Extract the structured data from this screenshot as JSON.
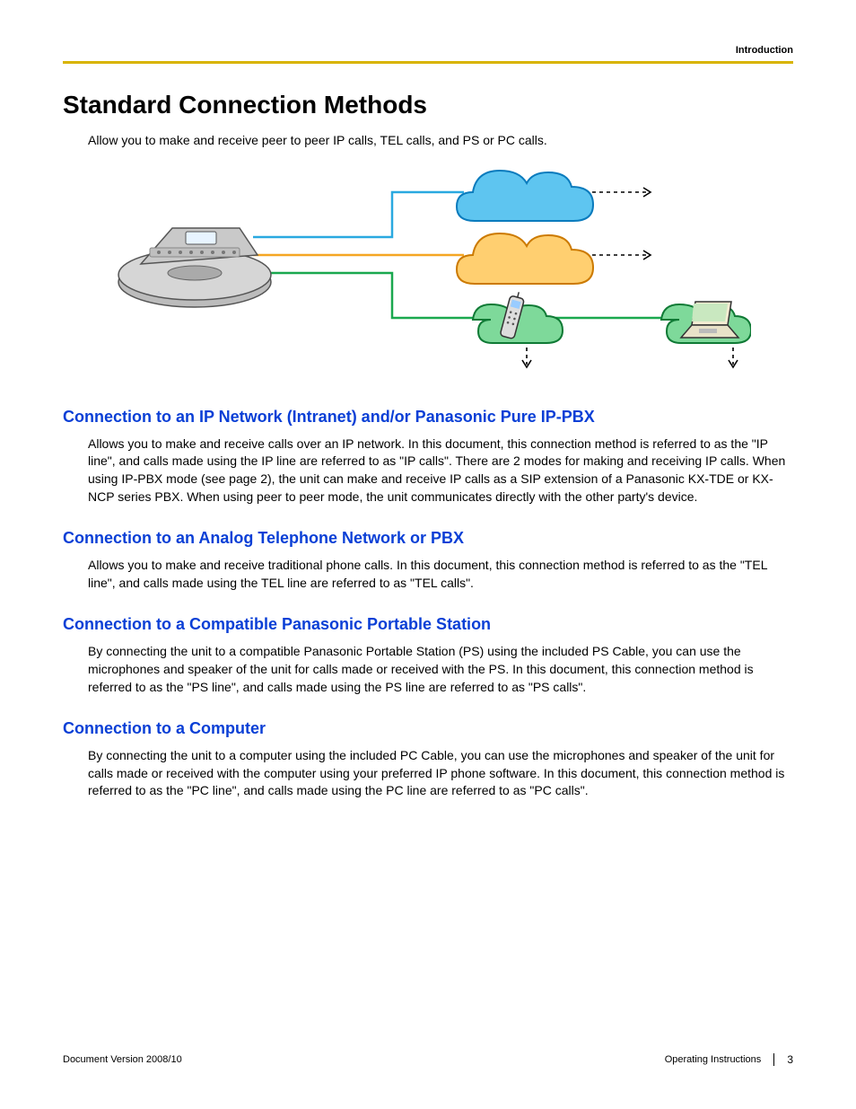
{
  "header": {
    "section_label": "Introduction"
  },
  "title": "Standard Connection Methods",
  "intro": "Allow you to make and receive peer to peer IP calls, TEL calls, and PS or PC calls.",
  "sections": [
    {
      "heading": "Connection to an IP Network (Intranet) and/or Panasonic Pure IP-PBX",
      "body": "Allows you to make and receive calls over an IP network.\nIn this document, this connection method is referred to as the \"IP line\", and calls made using the IP line are referred to as \"IP calls\". There are 2 modes for making and receiving IP calls. When using IP-PBX mode (see page 2), the unit can make and receive IP calls as a SIP extension of a Panasonic KX-TDE or KX-NCP series PBX. When using peer to peer mode, the unit communicates directly with the other party's device."
    },
    {
      "heading": "Connection to an Analog Telephone Network or PBX",
      "body": "Allows you to make and receive traditional phone calls.\nIn this document, this connection method is referred to as the \"TEL line\", and calls made using the TEL line are referred to as \"TEL calls\"."
    },
    {
      "heading": "Connection to a Compatible Panasonic Portable Station",
      "body": "By connecting the unit to a compatible Panasonic Portable Station (PS) using the included PS Cable, you can use the microphones and speaker of the unit for calls made or received with the PS.\nIn this document, this connection method is referred to as the \"PS line\", and calls made using the PS line are referred to as \"PS calls\"."
    },
    {
      "heading": "Connection to a Computer",
      "body": "By connecting the unit to a computer using the included PC Cable, you can use the microphones and speaker of the unit for calls made or received with the computer using your preferred IP phone software.\nIn this document, this connection method is referred to as the \"PC line\", and calls made using the PC line are referred to as \"PC calls\"."
    }
  ],
  "footer": {
    "left": "Document Version   2008/10",
    "right_label": "Operating Instructions",
    "page_number": "3"
  },
  "diagram": {
    "description": "Conference phone unit connected by three colored lines (blue, orange, green) to cloud shapes representing IP network, TEL network, and PS/PC devices, with dashed arrows continuing outward.",
    "nodes": {
      "device": "conference-phone",
      "cloud_blue": "ip-network-cloud",
      "cloud_orange": "tel-network-cloud",
      "cloud_green_ps": "ps-cloud",
      "cloud_green_pc": "pc-cloud"
    },
    "colors": {
      "blue": "#2aa9e0",
      "orange": "#f5a623",
      "green": "#1aa84f"
    }
  }
}
